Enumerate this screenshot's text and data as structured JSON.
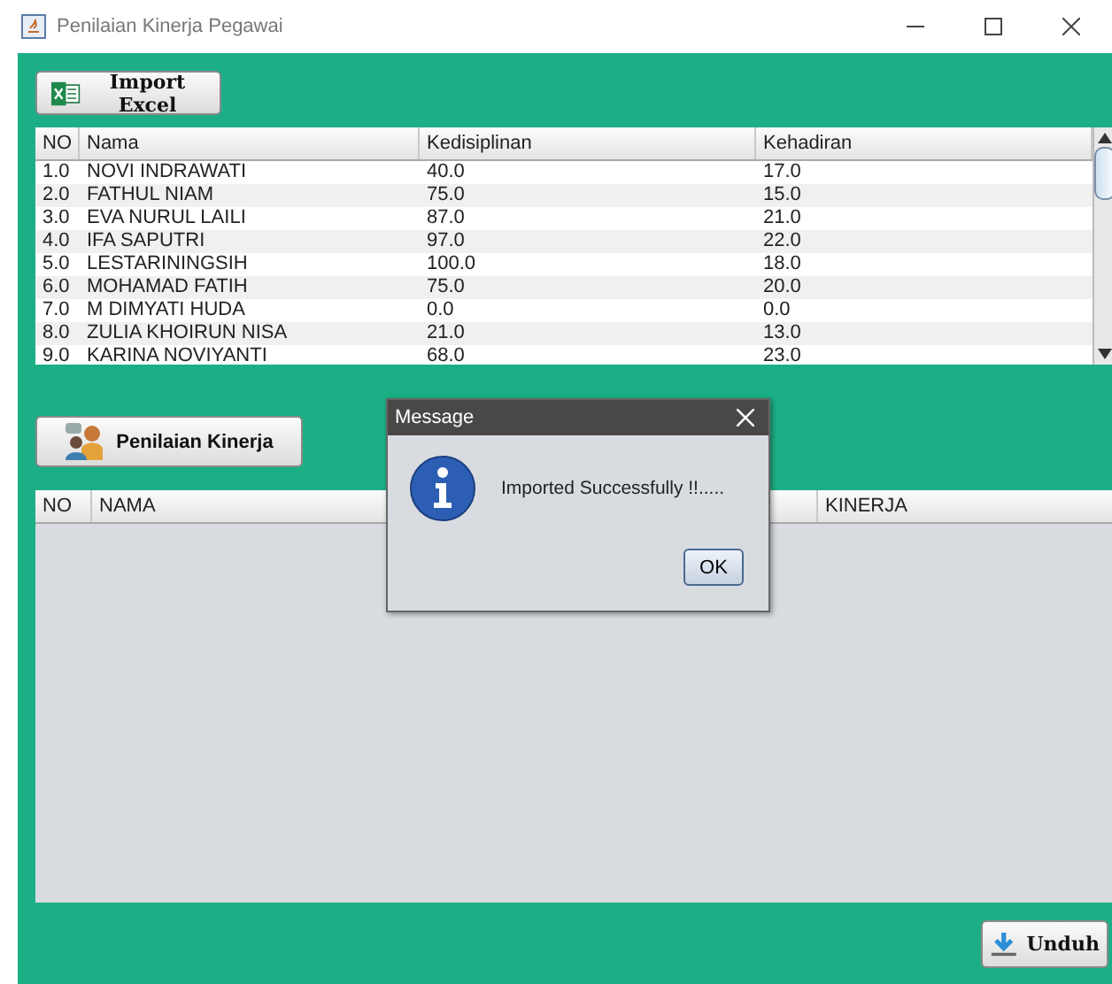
{
  "window": {
    "title": "Penilaian Kinerja Pegawai"
  },
  "import_button": {
    "label": "Import Excel"
  },
  "data_table": {
    "columns": [
      "NO",
      "Nama",
      "Kedisiplinan",
      "Kehadiran"
    ],
    "rows": [
      [
        "1.0",
        "NOVI INDRAWATI",
        "40.0",
        "17.0"
      ],
      [
        "2.0",
        "FATHUL NIAM",
        "75.0",
        "15.0"
      ],
      [
        "3.0",
        "EVA NURUL LAILI",
        "87.0",
        "21.0"
      ],
      [
        "4.0",
        "IFA SAPUTRI",
        "97.0",
        "22.0"
      ],
      [
        "5.0",
        "LESTARININGSIH",
        "100.0",
        "18.0"
      ],
      [
        "6.0",
        "MOHAMAD FATIH",
        "75.0",
        "20.0"
      ],
      [
        "7.0",
        "M DIMYATI HUDA",
        "0.0",
        "0.0"
      ],
      [
        "8.0",
        "ZULIA KHOIRUN NISA",
        "21.0",
        "13.0"
      ],
      [
        "9.0",
        "KARINA NOVIYANTI",
        "68.0",
        "23.0"
      ]
    ]
  },
  "assess_button": {
    "label": "Penilaian Kinerja"
  },
  "result_table": {
    "columns": [
      "NO",
      "NAMA",
      "KINERJA"
    ]
  },
  "download_button": {
    "label": "Unduh"
  },
  "dialog": {
    "title": "Message",
    "message": "Imported Successfully !!.....",
    "button": "OK"
  }
}
